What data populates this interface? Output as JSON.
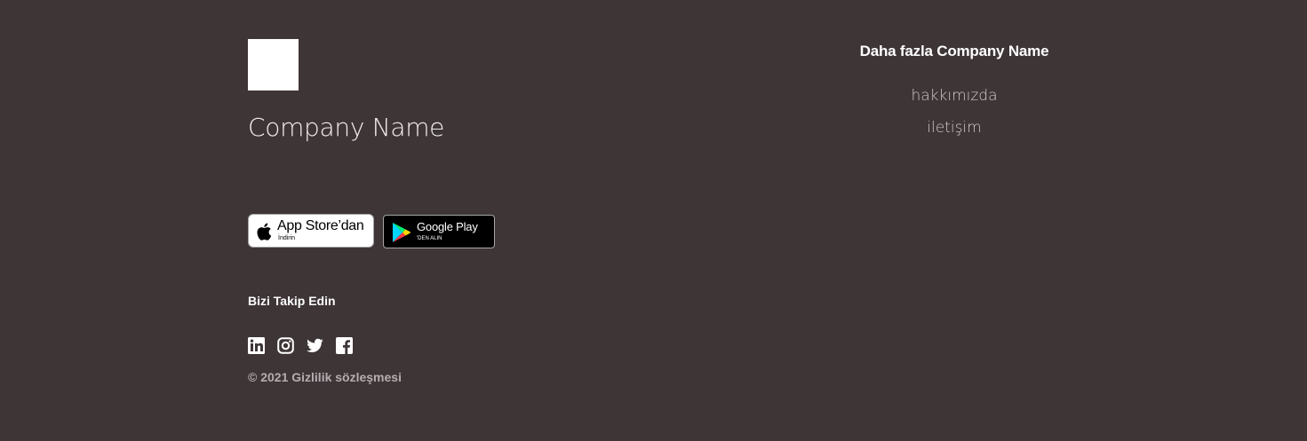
{
  "brand": {
    "company_name": "Company Name"
  },
  "store_badges": {
    "app_store": {
      "main_label": "App Store’dan",
      "sub_label": "İndirin",
      "icon": "apple-icon"
    },
    "google_play": {
      "main_label": "Google Play",
      "sub_label": "'DEN ALIN",
      "icon": "google-play-icon"
    }
  },
  "social": {
    "title": "Bizi Takip Edin",
    "icons": [
      "linkedin-icon",
      "instagram-icon",
      "twitter-icon",
      "facebook-icon"
    ]
  },
  "copyright": "© 2021 Gizlilik sözleşmesi",
  "more": {
    "title": "Daha fazla Company Name",
    "links": [
      {
        "label": "hakkımızda"
      },
      {
        "label": "iletişim"
      }
    ]
  },
  "colors": {
    "background": "#3e3537",
    "text_primary": "#ffffff",
    "text_muted": "#b5adaf",
    "link": "#cfc8ca"
  }
}
